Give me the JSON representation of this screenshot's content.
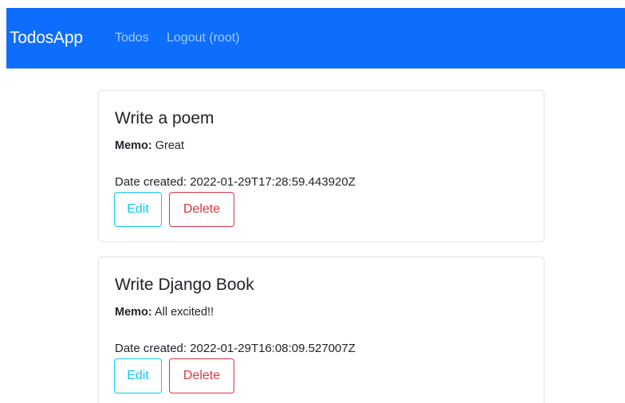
{
  "navbar": {
    "brand": "TodosApp",
    "links": [
      {
        "label": "Todos"
      },
      {
        "label": "Logout (root)"
      }
    ]
  },
  "todos": [
    {
      "title": "Write a poem",
      "memo_label": "Memo:",
      "memo": "Great",
      "date_created": "Date created: 2022-01-29T17:28:59.443920Z",
      "edit_label": "Edit",
      "delete_label": "Delete"
    },
    {
      "title": "Write Django Book",
      "memo_label": "Memo:",
      "memo": "All excited!!",
      "date_created": "Date created: 2022-01-29T16:08:09.527007Z",
      "edit_label": "Edit",
      "delete_label": "Delete"
    }
  ],
  "colors": {
    "navbar_bg": "#0d6efd",
    "edit_accent": "#0dcaf0",
    "delete_accent": "#dc3545"
  }
}
